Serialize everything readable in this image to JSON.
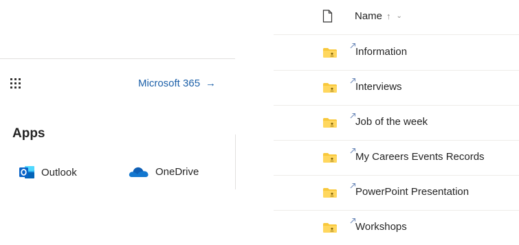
{
  "launcher": {
    "microsoft365_label": "Microsoft 365",
    "arrow_glyph": "→",
    "apps_heading": "Apps",
    "apps": [
      {
        "label": "Outlook",
        "icon": "outlook-icon",
        "color": "#0a64c8"
      },
      {
        "label": "OneDrive",
        "icon": "onedrive-icon",
        "color": "#1377cf"
      }
    ]
  },
  "file_list": {
    "header": {
      "column_label": "Name",
      "sort_glyph": "↑",
      "chevron_glyph": "⌄"
    },
    "folders": [
      {
        "name": "Information"
      },
      {
        "name": "Interviews"
      },
      {
        "name": "Job of the week"
      },
      {
        "name": "My Careers Events Records"
      },
      {
        "name": "PowerPoint Presentation"
      },
      {
        "name": "Workshops"
      }
    ],
    "folder_color": "#f8c83c",
    "shortcut_color": "#6b88b8"
  },
  "colors": {
    "link": "#1b5fa8",
    "divider": "#edebe9"
  }
}
